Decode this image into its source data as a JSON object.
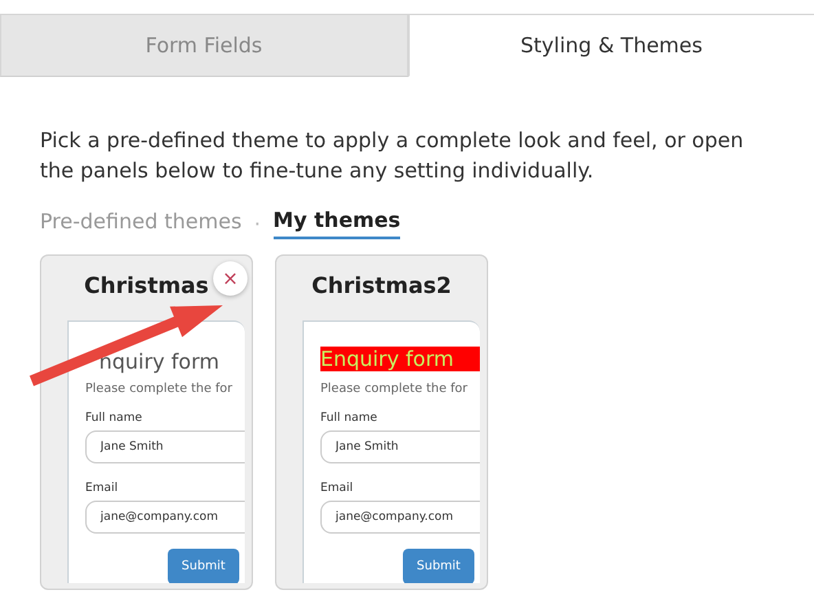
{
  "tabs": [
    {
      "label": "Form Fields",
      "selected": false
    },
    {
      "label": "Styling & Themes",
      "selected": true
    }
  ],
  "intro": "Pick a pre-defined theme to apply a complete look and feel, or open the panels below to fine-tune any setting individually.",
  "subtabs": [
    {
      "label": "Pre-defined themes",
      "selected": false
    },
    {
      "label": "My themes",
      "selected": true
    }
  ],
  "separator": "·",
  "themes": [
    {
      "name": "Christmas",
      "removable": true,
      "close": "×",
      "kind": "plain",
      "form": {
        "title": "nquiry form",
        "description": "Please complete the for",
        "fields": [
          {
            "label": "Full name",
            "value": "Jane Smith"
          },
          {
            "label": "Email",
            "value": "jane@company.com"
          }
        ],
        "submit": "Submit"
      }
    },
    {
      "name": "Christmas2",
      "removable": false,
      "kind": "highlighted",
      "form": {
        "title": "Enquiry form",
        "description": "Please complete the for",
        "fields": [
          {
            "label": "Full name",
            "value": "Jane Smith"
          },
          {
            "label": "Email",
            "value": "jane@company.com"
          }
        ],
        "submit": "Submit"
      }
    }
  ]
}
